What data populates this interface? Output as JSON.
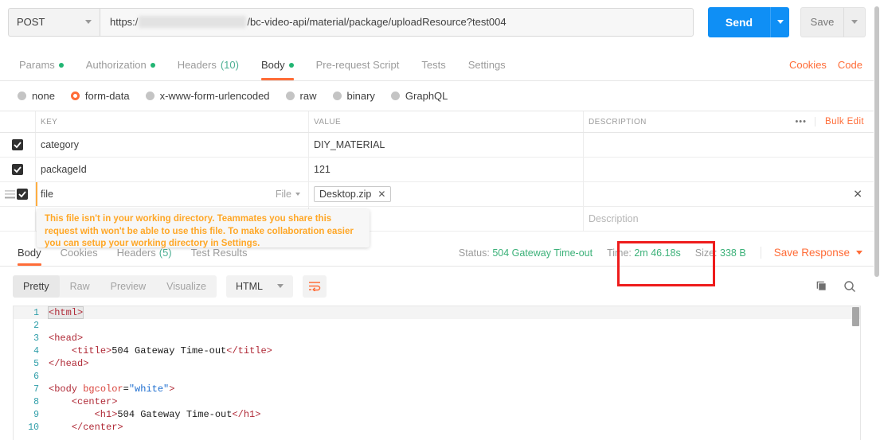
{
  "request": {
    "method": "POST",
    "url_prefix": "https:/",
    "url_suffix": "/bc-video-api/material/package/uploadResource?test004",
    "send_label": "Send",
    "save_label": "Save"
  },
  "request_tabs": [
    {
      "label": "Params",
      "dot": true,
      "active": false
    },
    {
      "label": "Authorization",
      "dot": true,
      "active": false
    },
    {
      "label": "Headers",
      "count": "(10)",
      "active": false
    },
    {
      "label": "Body",
      "dot": true,
      "active": true
    },
    {
      "label": "Pre-request Script",
      "active": false
    },
    {
      "label": "Tests",
      "active": false
    },
    {
      "label": "Settings",
      "active": false
    }
  ],
  "request_tabs_right": [
    {
      "label": "Cookies"
    },
    {
      "label": "Code"
    }
  ],
  "body_types": [
    {
      "label": "none",
      "selected": false
    },
    {
      "label": "form-data",
      "selected": true
    },
    {
      "label": "x-www-form-urlencoded",
      "selected": false
    },
    {
      "label": "raw",
      "selected": false
    },
    {
      "label": "binary",
      "selected": false
    },
    {
      "label": "GraphQL",
      "selected": false
    }
  ],
  "kv_table": {
    "headers": {
      "key": "KEY",
      "value": "VALUE",
      "description": "DESCRIPTION"
    },
    "dots_label": "•••",
    "bulk_edit_label": "Bulk Edit",
    "rows": [
      {
        "checked": true,
        "key": "category",
        "value": "DIY_MATERIAL",
        "description": ""
      },
      {
        "checked": true,
        "key": "packageId",
        "value": "121",
        "description": ""
      },
      {
        "checked": true,
        "key": "file",
        "type_label": "File",
        "file_chip": "Desktop.zip",
        "chip_close": "✕",
        "description": ""
      },
      {
        "checked": false,
        "key": "",
        "value": "",
        "description_placeholder": "Description"
      }
    ]
  },
  "tooltip": {
    "text": "This file isn't in your working directory. Teammates you share this request with won't be able to use this file. To make collaboration easier you can setup your working directory in Settings."
  },
  "response_tabs": [
    {
      "label": "Body",
      "active": true
    },
    {
      "label": "Cookies",
      "active": false
    },
    {
      "label": "Headers",
      "count": "(5)",
      "active": false
    },
    {
      "label": "Test Results",
      "active": false
    }
  ],
  "response_meta": {
    "status_label": "Status:",
    "status_value": "504 Gateway Time-out",
    "time_label": "Time:",
    "time_value": "2m 46.18s",
    "size_label": "Size:",
    "size_value": "338 B",
    "save_response_label": "Save Response"
  },
  "response_tools": {
    "views": [
      {
        "label": "Pretty",
        "active": true
      },
      {
        "label": "Raw",
        "active": false
      },
      {
        "label": "Preview",
        "active": false
      },
      {
        "label": "Visualize",
        "active": false
      }
    ],
    "format": "HTML"
  },
  "code_lines": [
    {
      "n": "1",
      "html": "<span class=\"tg cursor-box\">&lt;html&gt;</span>",
      "highlight": true
    },
    {
      "n": "2",
      "html": ""
    },
    {
      "n": "3",
      "html": "<span class=\"tg\">&lt;head&gt;</span>"
    },
    {
      "n": "4",
      "html": "    <span class=\"tg\">&lt;title&gt;</span>504 Gateway Time-out<span class=\"tg\">&lt;/title&gt;</span>"
    },
    {
      "n": "5",
      "html": "<span class=\"tg\">&lt;/head&gt;</span>"
    },
    {
      "n": "6",
      "html": ""
    },
    {
      "n": "7",
      "html": "<span class=\"tg\">&lt;body </span><span class=\"at\">bgcolor</span>=<span class=\"st\">\"white\"</span><span class=\"tg\">&gt;</span>"
    },
    {
      "n": "8",
      "html": "    <span class=\"tg\">&lt;center&gt;</span>"
    },
    {
      "n": "9",
      "html": "        <span class=\"tg\">&lt;h1&gt;</span>504 Gateway Time-out<span class=\"tg\">&lt;/h1&gt;</span>"
    },
    {
      "n": "10",
      "html": "    <span class=\"tg\">&lt;/center&gt;</span>"
    }
  ],
  "colors": {
    "accent": "#ff6c37",
    "send_blue": "#0f8ff5",
    "status_green": "#3cb179",
    "annotation_red": "#ee1c1c",
    "tooltip_orange": "#ffa726"
  },
  "icons": {
    "drag_handle": "drag-handle-icon",
    "copy": "copy-icon",
    "search": "search-icon",
    "wrap": "word-wrap-icon"
  }
}
